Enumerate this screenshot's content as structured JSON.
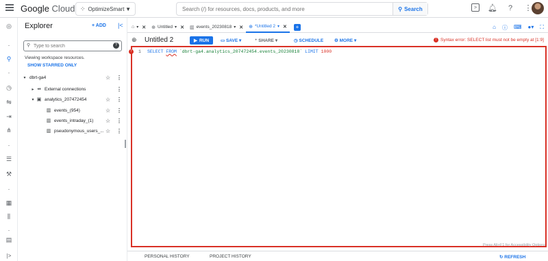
{
  "header": {
    "logo_google": "Google",
    "logo_cloud": "Cloud",
    "project_name": "OptimizeSmart",
    "search_placeholder": "Search (/) for resources, docs, products, and more",
    "search_button": "Search",
    "icons": [
      "terminal-icon",
      "bell-icon",
      "help-icon",
      "more-icon"
    ]
  },
  "explorer": {
    "title": "Explorer",
    "add_label": "ADD",
    "search_placeholder": "Type to search",
    "hint": "Viewing workspace resources.",
    "show_starred": "SHOW STARRED ONLY",
    "tree": [
      {
        "label": "dbrt-ga4",
        "level": 0
      },
      {
        "label": "External connections",
        "level": 1
      },
      {
        "label": "analytics_207472454",
        "level": 1
      },
      {
        "label": "events_(954)",
        "level": 2
      },
      {
        "label": "events_intraday_(1)",
        "level": 2
      },
      {
        "label": "pseudonymous_users_...",
        "level": 2
      }
    ]
  },
  "tabs": [
    {
      "label": "",
      "icon": "home-icon"
    },
    {
      "label": "Untitled",
      "icon": "query-icon"
    },
    {
      "label": "events_20230818",
      "icon": "table-icon"
    },
    {
      "label": "*Untitled 2",
      "icon": "query-icon",
      "active": true
    }
  ],
  "toolbar": {
    "title": "Untitled 2",
    "run": "RUN",
    "save": "SAVE",
    "share": "SHARE",
    "schedule": "SCHEDULE",
    "more": "MORE",
    "error": "Syntax error: SELECT list must not be empty at [1:9]"
  },
  "editor": {
    "line_number": "1",
    "kw_select": "SELECT",
    "kw_from": "FROM",
    "table_ref": "`dbrt-ga4.analytics_207472454.events_20230818`",
    "kw_limit": "LIMIT",
    "limit_value": "1000",
    "a11y_hint": "Press Alt+F1 for Accessibility Options"
  },
  "bottom": {
    "personal_history": "PERSONAL HISTORY",
    "project_history": "PROJECT HISTORY",
    "refresh": "REFRESH"
  },
  "colors": {
    "accent": "#1a73e8",
    "error": "#d93025",
    "string": "#188038"
  }
}
